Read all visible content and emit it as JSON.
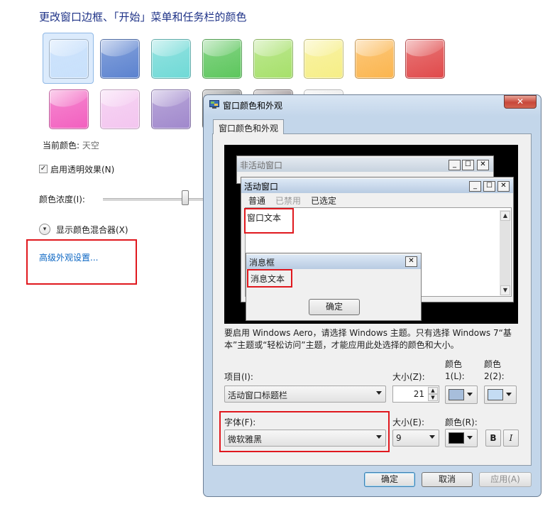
{
  "background_panel": {
    "title": "更改窗口边框、「开始」菜单和任务栏的颜色",
    "swatches": {
      "row1": [
        "#c8e0fb",
        "#5b82cf",
        "#6fd9d6",
        "#5cc65c",
        "#a6e06a",
        "#f6ee86",
        "#fbb54e",
        "#e0494a"
      ],
      "row2": [
        "#f25fbf",
        "#f3c5ef",
        "#a088cc",
        "#7d7d7d",
        "#8a8082",
        "#e6e6e6"
      ]
    },
    "current_color_label": "当前颜色:",
    "current_color_value": "天空",
    "transparency_checked": "✓",
    "transparency_label": "启用透明效果(N)",
    "intensity_label": "颜色浓度(I):",
    "intensity_fraction": 0.8,
    "mixer_label": "显示颜色混合器(X)",
    "advanced_link": "高级外观设置..."
  },
  "dialog": {
    "title": "窗口颜色和外观",
    "close_glyph": "✕",
    "tab_label": "窗口颜色和外观",
    "preview": {
      "inactive_title": "非活动窗口",
      "active_title": "活动窗口",
      "menu_normal": "普通",
      "menu_disabled": "已禁用",
      "menu_selected": "已选定",
      "window_text": "窗口文本",
      "msgbox_title": "消息框",
      "msgbox_text": "消息文本",
      "ok_button": "确定",
      "caption_min": "_",
      "caption_max": "☐",
      "caption_close": "✕",
      "scroll_up": "▲",
      "scroll_down": "▼"
    },
    "description": "要启用 Windows Aero，请选择 Windows 主题。只有选择 Windows 7“基本”主题或“轻松访问”主题，才能应用此处选择的颜色和大小。",
    "item_label": "项目(I):",
    "item_value": "活动窗口标题栏",
    "size_label": "大小(Z):",
    "size_value": "21",
    "color1_label": "颜色 1(L):",
    "color2_label": "颜色 2(2):",
    "color1": "#a7bedb",
    "color2": "#c4dcf3",
    "font_label": "字体(F):",
    "font_value": "微软雅黑",
    "font_size_label": "大小(E):",
    "font_size_value": "9",
    "font_color_label": "颜色(R):",
    "font_color": "#000000",
    "bold_label": "B",
    "italic_label": "I",
    "ok": "确定",
    "cancel": "取消",
    "apply": "应用(A)"
  }
}
